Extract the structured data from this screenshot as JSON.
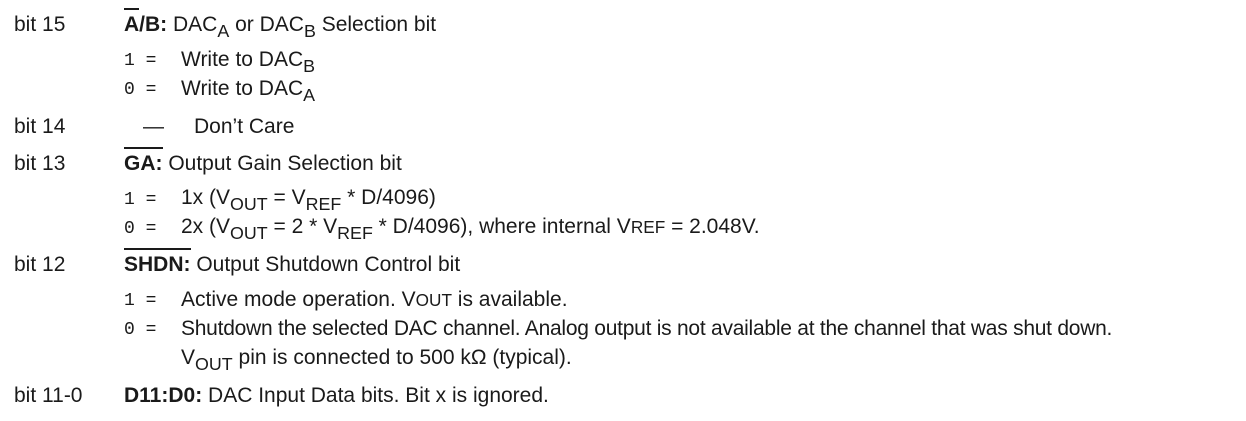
{
  "bit15": {
    "label": "bit 15",
    "name_over": "A",
    "name_rest": "/B:",
    "desc_pre": " DAC",
    "desc_sub_a": "A",
    "desc_mid": " or DAC",
    "desc_sub_b": "B",
    "desc_post": " Selection bit",
    "opt1_code": "1 =",
    "opt1_pre": "Write to DAC",
    "opt1_sub": "B",
    "opt0_code": "0 =",
    "opt0_pre": "Write to DAC",
    "opt0_sub": "A"
  },
  "bit14": {
    "label": "bit 14",
    "dash": "—",
    "text": "Don’t Care"
  },
  "bit13": {
    "label": "bit 13",
    "name": "GA:",
    "desc": " Output Gain Selection bit",
    "opt1_code": "1 =",
    "opt1_a": "1x (V",
    "opt1_sub_out": "OUT",
    "opt1_b": " = V",
    "opt1_sub_ref": "REF",
    "opt1_c": " * D/4096)",
    "opt0_code": "0 =",
    "opt0_a": "2x (V",
    "opt0_sub_out": "OUT",
    "opt0_b": " = 2 * V",
    "opt0_sub_ref": "REF",
    "opt0_c": " * D/4096),  where internal V",
    "opt0_sc": "REF",
    "opt0_d": " = 2.048V."
  },
  "bit12": {
    "label": "bit 12",
    "name": "SHDN:",
    "desc": " Output Shutdown Control bit",
    "opt1_code": "1 =",
    "opt1_a": "Active mode operation. V",
    "opt1_sc": "OUT",
    "opt1_b": " is available.",
    "opt0_code": "0 =",
    "opt0_line1": "Shutdown the selected DAC channel. Analog output is not available at the channel that was shut down.",
    "opt0_l2a": "V",
    "opt0_l2sub": "OUT",
    "opt0_l2b": " pin is connected to 500 kΩ (typical)."
  },
  "bit11": {
    "label": "bit 11-0",
    "name": "D11:D0:",
    "desc": " DAC Input Data bits. Bit x is ignored."
  }
}
